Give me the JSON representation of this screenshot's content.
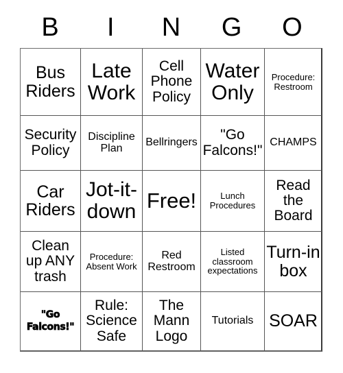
{
  "card": {
    "title": "BINGO Card",
    "header_letters": [
      "B",
      "I",
      "N",
      "G",
      "O"
    ],
    "columns": 5,
    "rows": 5,
    "free_space_label": "Free!",
    "free_space_position": "row3-col3",
    "grid_line_color": "#555555",
    "text_color": "#000000",
    "background_color": "#ffffff",
    "cells": [
      [
        {
          "text": "Bus Riders",
          "size": "lg",
          "style": "normal"
        },
        {
          "text": "Late Work",
          "size": "xl",
          "style": "normal"
        },
        {
          "text": "Cell Phone Policy",
          "size": "md",
          "style": "normal"
        },
        {
          "text": "Water Only",
          "size": "xl",
          "style": "normal"
        },
        {
          "text": "Procedure: Restroom",
          "size": "xs",
          "style": "normal"
        }
      ],
      [
        {
          "text": "Security Policy",
          "size": "md",
          "style": "normal"
        },
        {
          "text": "Discipline Plan",
          "size": "sm",
          "style": "normal"
        },
        {
          "text": "Bellringers",
          "size": "sm",
          "style": "normal"
        },
        {
          "text": "\"Go Falcons!\"",
          "size": "md",
          "style": "normal"
        },
        {
          "text": "CHAMPS",
          "size": "sm",
          "style": "normal"
        }
      ],
      [
        {
          "text": "Car Riders",
          "size": "lg",
          "style": "normal"
        },
        {
          "text": "Jot-it-down",
          "size": "xl",
          "style": "normal"
        },
        {
          "text": "Free!",
          "size": "free",
          "style": "free"
        },
        {
          "text": "Lunch Procedures",
          "size": "xs",
          "style": "normal"
        },
        {
          "text": "Read the Board",
          "size": "md",
          "style": "normal"
        }
      ],
      [
        {
          "text": "Clean up ANY trash",
          "size": "md",
          "style": "normal"
        },
        {
          "text": "Procedure: Absent Work",
          "size": "xs",
          "style": "normal"
        },
        {
          "text": "Red Restroom",
          "size": "sm",
          "style": "normal"
        },
        {
          "text": "Listed classroom expectations",
          "size": "xs",
          "style": "normal"
        },
        {
          "text": "Turn-in box",
          "size": "lg",
          "style": "normal"
        }
      ],
      [
        {
          "text": "\"Go Falcons!\"",
          "size": "xs",
          "style": "heavy"
        },
        {
          "text": "Rule: Science Safe",
          "size": "md",
          "style": "normal"
        },
        {
          "text": "The Mann Logo",
          "size": "md",
          "style": "normal"
        },
        {
          "text": "Tutorials",
          "size": "sm",
          "style": "normal"
        },
        {
          "text": "SOAR",
          "size": "lg",
          "style": "normal"
        }
      ]
    ]
  }
}
